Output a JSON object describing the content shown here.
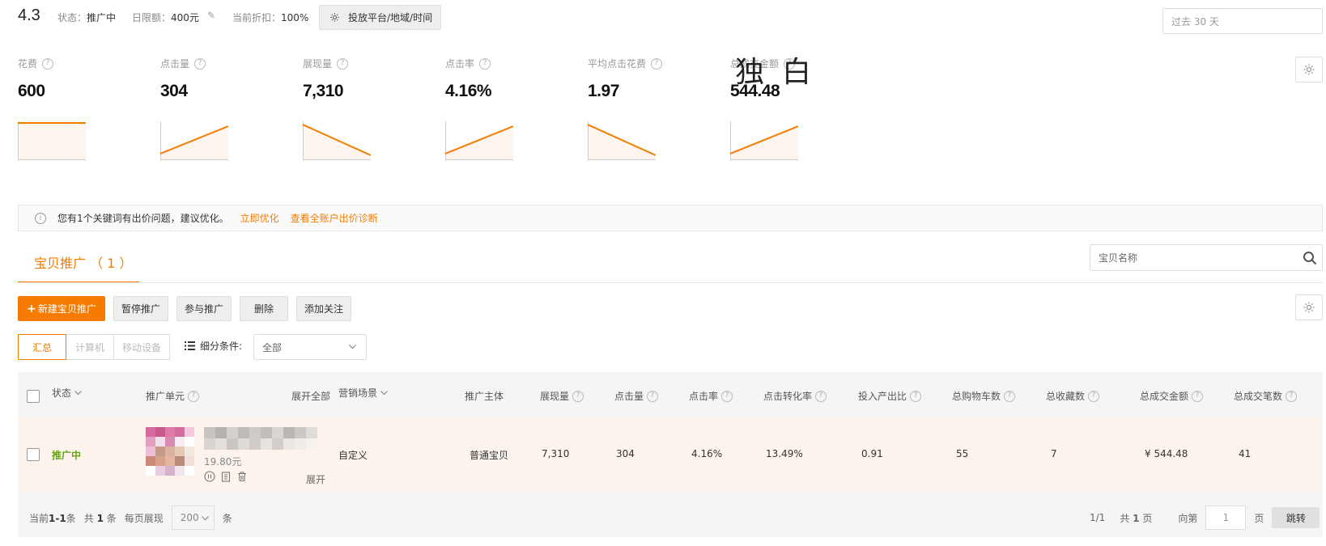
{
  "header": {
    "plan_name": "4.3",
    "status_label": "状态：",
    "status_value": "推广中",
    "budget_label": "日限额：",
    "budget_value": "400元",
    "discount_label": "当前折扣：",
    "discount_value": "100%",
    "platform_button": "投放平台/地域/时间",
    "date_range_placeholder": "过去 30 天"
  },
  "metrics": [
    {
      "label": "花费",
      "value": "600",
      "trend": "flat"
    },
    {
      "label": "点击量",
      "value": "304",
      "trend": "up"
    },
    {
      "label": "展现量",
      "value": "7,310",
      "trend": "down"
    },
    {
      "label": "点击率",
      "value": "4.16%",
      "trend": "up"
    },
    {
      "label": "平均点击花费",
      "value": "1.97",
      "trend": "down"
    },
    {
      "label": "总成交金额",
      "value": "544.48",
      "trend": "up"
    }
  ],
  "watermark_text": "独白",
  "notice": {
    "text": "您有1个关键词有出价问题，建议优化。",
    "link_optimize": "立即优化",
    "link_diagnose": "查看全账户出价诊断"
  },
  "tabs": {
    "active_label": "宝贝推广 （ 1 ）",
    "search_placeholder": "宝贝名称"
  },
  "actions": {
    "new_label": "新建宝贝推广",
    "pause_label": "暂停推广",
    "join_label": "参与推广",
    "delete_label": "删除",
    "follow_label": "添加关注"
  },
  "devices": [
    "汇总",
    "计算机",
    "移动设备"
  ],
  "filter": {
    "label": "细分条件:",
    "value": "全部"
  },
  "table": {
    "headers": {
      "status": "状态",
      "unit": "推广单元",
      "expand_all": "展开全部",
      "scene": "营销场景",
      "subject": "推广主体",
      "impressions": "展现量",
      "clicks": "点击量",
      "ctr": "点击率",
      "cvr": "点击转化率",
      "roi": "投入产出比",
      "cart": "总购物车数",
      "favorites": "总收藏数",
      "gmv": "总成交金额",
      "orders": "总成交笔数"
    },
    "rows": [
      {
        "status": "推广中",
        "price": "19.80元",
        "scene": "自定义",
        "subject": "普通宝贝",
        "impressions": "7,310",
        "clicks": "304",
        "ctr": "4.16%",
        "cvr": "13.49%",
        "roi": "0.91",
        "cart": "55",
        "favorites": "7",
        "gmv": "¥ 544.48",
        "orders": "41",
        "expand": "展开"
      }
    ]
  },
  "pager": {
    "current_prefix": "当前",
    "current_range": "1-1",
    "current_suffix": "条",
    "total_prefix": "共",
    "total_count": "1",
    "total_suffix": "条",
    "per_page_label": "每页展现",
    "per_page_value": "200",
    "per_page_unit": "条",
    "page_of": "1/1",
    "pages_prefix": "共",
    "pages_count": "1",
    "pages_suffix": "页",
    "goto_label": "向第",
    "goto_value": "1",
    "goto_unit": "页",
    "jump_label": "跳转"
  },
  "colors": {
    "accent": "#f57c00",
    "status_active": "#6aa417"
  }
}
